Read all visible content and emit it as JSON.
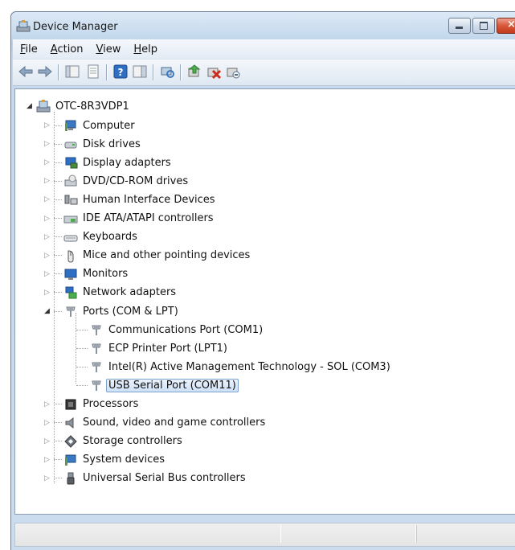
{
  "window": {
    "title": "Device Manager",
    "close_glyph": "×"
  },
  "menu": [
    {
      "label_u": "F",
      "label_rest": "ile"
    },
    {
      "label_u": "A",
      "label_rest": "ction"
    },
    {
      "label_u": "V",
      "label_rest": "iew"
    },
    {
      "label_u": "H",
      "label_rest": "elp"
    }
  ],
  "tree": {
    "root": {
      "label": "OTC-8R3VDP1",
      "icon": "computer-root-icon",
      "expanded": true
    },
    "categories": [
      {
        "label": "Computer",
        "icon": "computer-icon"
      },
      {
        "label": "Disk drives",
        "icon": "disk-drive-icon"
      },
      {
        "label": "Display adapters",
        "icon": "display-adapter-icon"
      },
      {
        "label": "DVD/CD-ROM drives",
        "icon": "dvd-drive-icon"
      },
      {
        "label": "Human Interface Devices",
        "icon": "hid-icon"
      },
      {
        "label": "IDE ATA/ATAPI controllers",
        "icon": "ide-controller-icon"
      },
      {
        "label": "Keyboards",
        "icon": "keyboard-icon"
      },
      {
        "label": "Mice and other pointing devices",
        "icon": "mouse-icon"
      },
      {
        "label": "Monitors",
        "icon": "monitor-icon"
      },
      {
        "label": "Network adapters",
        "icon": "network-adapter-icon"
      },
      {
        "label": "Ports (COM & LPT)",
        "icon": "port-icon",
        "expanded": true,
        "children": [
          {
            "label": "Communications Port (COM1)",
            "icon": "port-icon"
          },
          {
            "label": "ECP Printer Port (LPT1)",
            "icon": "port-icon"
          },
          {
            "label": "Intel(R) Active Management Technology - SOL (COM3)",
            "icon": "port-icon"
          },
          {
            "label": "USB Serial Port (COM11)",
            "icon": "port-icon",
            "selected": true
          }
        ]
      },
      {
        "label": "Processors",
        "icon": "processor-icon"
      },
      {
        "label": "Sound, video and game controllers",
        "icon": "sound-icon"
      },
      {
        "label": "Storage controllers",
        "icon": "storage-controller-icon"
      },
      {
        "label": "System devices",
        "icon": "system-devices-icon"
      },
      {
        "label": "Universal Serial Bus controllers",
        "icon": "usb-icon"
      }
    ]
  }
}
